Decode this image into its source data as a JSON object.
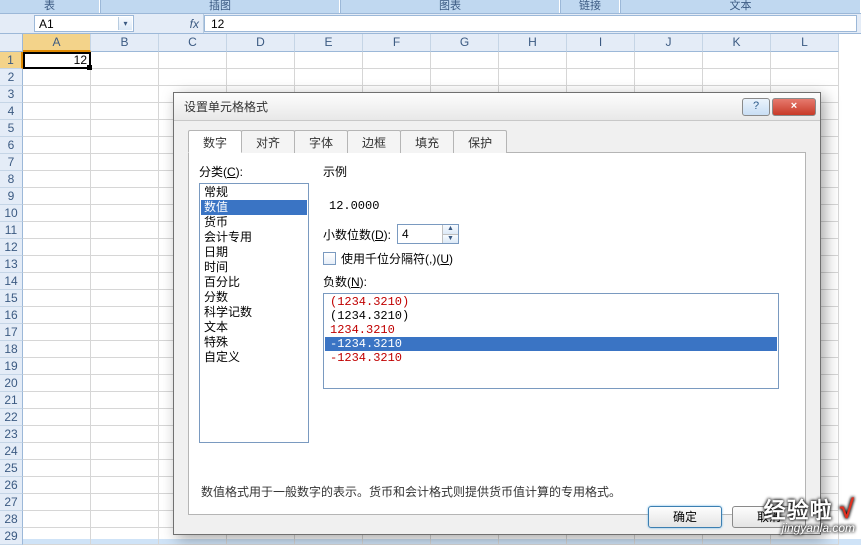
{
  "ribbon": {
    "groups": [
      "表",
      "插图",
      "图表",
      "链接",
      "文本"
    ]
  },
  "namebox": "A1",
  "fx": "fx",
  "formula_value": "12",
  "columns": [
    "A",
    "B",
    "C",
    "D",
    "E",
    "F",
    "G",
    "H",
    "I",
    "J",
    "K",
    "L"
  ],
  "rows": [
    "1",
    "2",
    "3",
    "4",
    "5",
    "6",
    "7",
    "8",
    "9",
    "10",
    "11",
    "12",
    "13",
    "14",
    "15",
    "16",
    "17",
    "18",
    "19",
    "20",
    "21",
    "22",
    "23",
    "24",
    "25",
    "26",
    "27",
    "28",
    "29"
  ],
  "cell_a1": "12",
  "dialog": {
    "title": "设置单元格格式",
    "help": "?",
    "close": "×",
    "tabs": [
      "数字",
      "对齐",
      "字体",
      "边框",
      "填充",
      "保护"
    ],
    "category_label": "分类(C):",
    "categories": [
      "常规",
      "数值",
      "货币",
      "会计专用",
      "日期",
      "时间",
      "百分比",
      "分数",
      "科学记数",
      "文本",
      "特殊",
      "自定义"
    ],
    "selected_category_index": 1,
    "sample_label": "示例",
    "sample_value": "12.0000",
    "decimals_label": "小数位数(D):",
    "decimals_value": "4",
    "thousands_label": "使用千位分隔符(,)(U)",
    "negatives_label": "负数(N):",
    "negatives": [
      {
        "text": "(1234.3210)",
        "red": true
      },
      {
        "text": "(1234.3210)",
        "red": false
      },
      {
        "text": "1234.3210",
        "red": true
      },
      {
        "text": "-1234.3210",
        "red": false
      },
      {
        "text": "-1234.3210",
        "red": true
      }
    ],
    "selected_negative_index": 3,
    "description": "数值格式用于一般数字的表示。货币和会计格式则提供货币值计算的专用格式。",
    "ok": "确定",
    "cancel": "取消"
  },
  "watermark": {
    "big": "经验啦",
    "check": "√",
    "small": "jingyanla.com"
  }
}
